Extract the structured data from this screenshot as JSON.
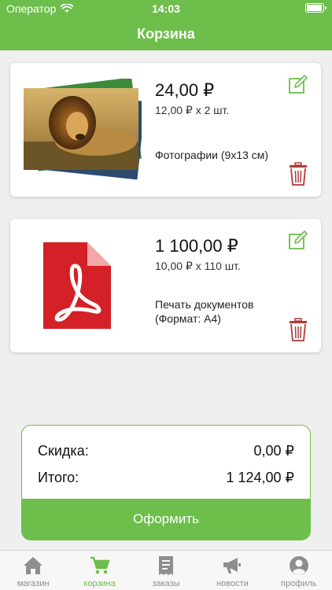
{
  "status_bar": {
    "carrier": "Оператор",
    "time": "14:03",
    "battery_level": 0.95
  },
  "header": {
    "title": "Корзина"
  },
  "cart": {
    "items": [
      {
        "price": "24,00 ₽",
        "qty": "12,00 ₽ x 2 шт.",
        "desc": "Фотографии (9x13 см)",
        "thumbnail_icon": "lion-photo-stack-icon"
      },
      {
        "price": "1 100,00 ₽",
        "qty": "10,00 ₽ x 110 шт.",
        "desc_line1": "Печать документов",
        "desc_line2": "(Формат: A4)",
        "thumbnail_icon": "pdf-file-icon"
      }
    ]
  },
  "summary": {
    "discount_label": "Скидка:",
    "discount_value": "0,00 ₽",
    "total_label": "Итого:",
    "total_value": "1 124,00 ₽",
    "checkout_label": "Оформить"
  },
  "tabs": [
    {
      "label": "магазин",
      "icon": "home-icon",
      "active": false
    },
    {
      "label": "корзина",
      "icon": "cart-icon",
      "active": true
    },
    {
      "label": "заказы",
      "icon": "receipt-icon",
      "active": false
    },
    {
      "label": "новости",
      "icon": "megaphone-icon",
      "active": false
    },
    {
      "label": "профиль",
      "icon": "user-icon",
      "active": false
    }
  ],
  "colors": {
    "accent": "#6dbe4b",
    "delete_icon": "#b23a3a",
    "pdf": "#d42027",
    "background": "#efefef"
  }
}
